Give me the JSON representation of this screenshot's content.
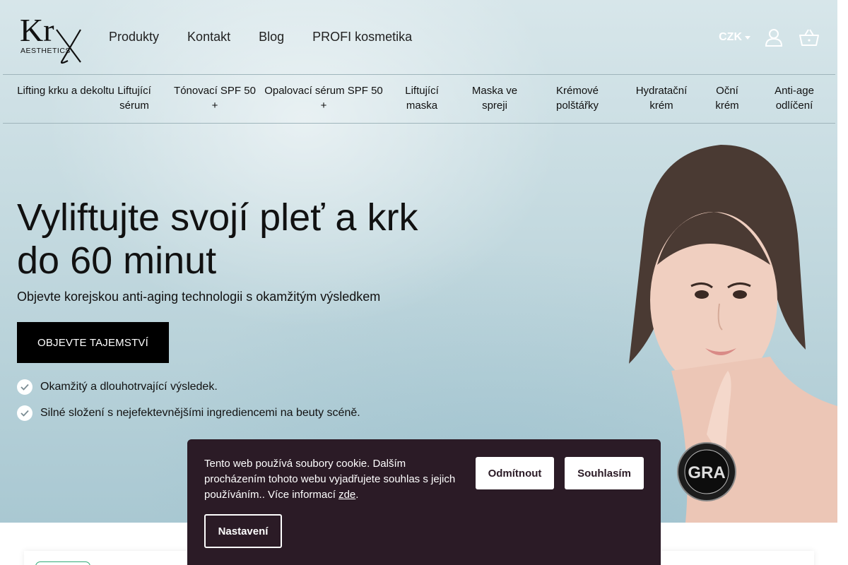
{
  "brand": {
    "logo_mark": "Kr",
    "logo_sub": "AESTHETICS"
  },
  "main_nav": [
    "Produkty",
    "Kontakt",
    "Blog",
    "PROFI kosmetika"
  ],
  "header": {
    "currency": "CZK",
    "user_icon": "user-icon",
    "cart_icon": "basket-icon"
  },
  "categories": [
    "Lifting krku a dekoltu",
    "Liftující sérum",
    "Tónovací SPF 50 +",
    "Opalovací sérum SPF 50 +",
    "Liftující maska",
    "Maska ve spreji",
    "Krémové polštářky",
    "Hydratační krém",
    "Oční krém",
    "Anti-age odlíčení"
  ],
  "hero": {
    "title": "Vyliftujte svojí pleť a krk do 60 minut",
    "subtitle": "Objevte korejskou anti-aging technologii s okamžitým výsledkem",
    "cta": "OBJEVTE TAJEMSTVÍ",
    "benefits": [
      "Okamžitý a dlouhotrvající výsledek.",
      "Silné složení s nejefektevnějšími ingrediencemi na beuty scéně."
    ],
    "badge_text": "GRA"
  },
  "cookie": {
    "text": "Tento web používá soubory cookie. Dalším procházením tohoto webu vyjadřujete souhlas s jejich používáním.. Více informací ",
    "link": "zde",
    "after_link": ".",
    "decline": "Odmítnout",
    "accept": "Souhlasím",
    "settings": "Nastavení"
  },
  "colors": {
    "accent": "#000000",
    "cookie_bg": "#2b1b26",
    "hero_bg": "#c3d9df"
  }
}
